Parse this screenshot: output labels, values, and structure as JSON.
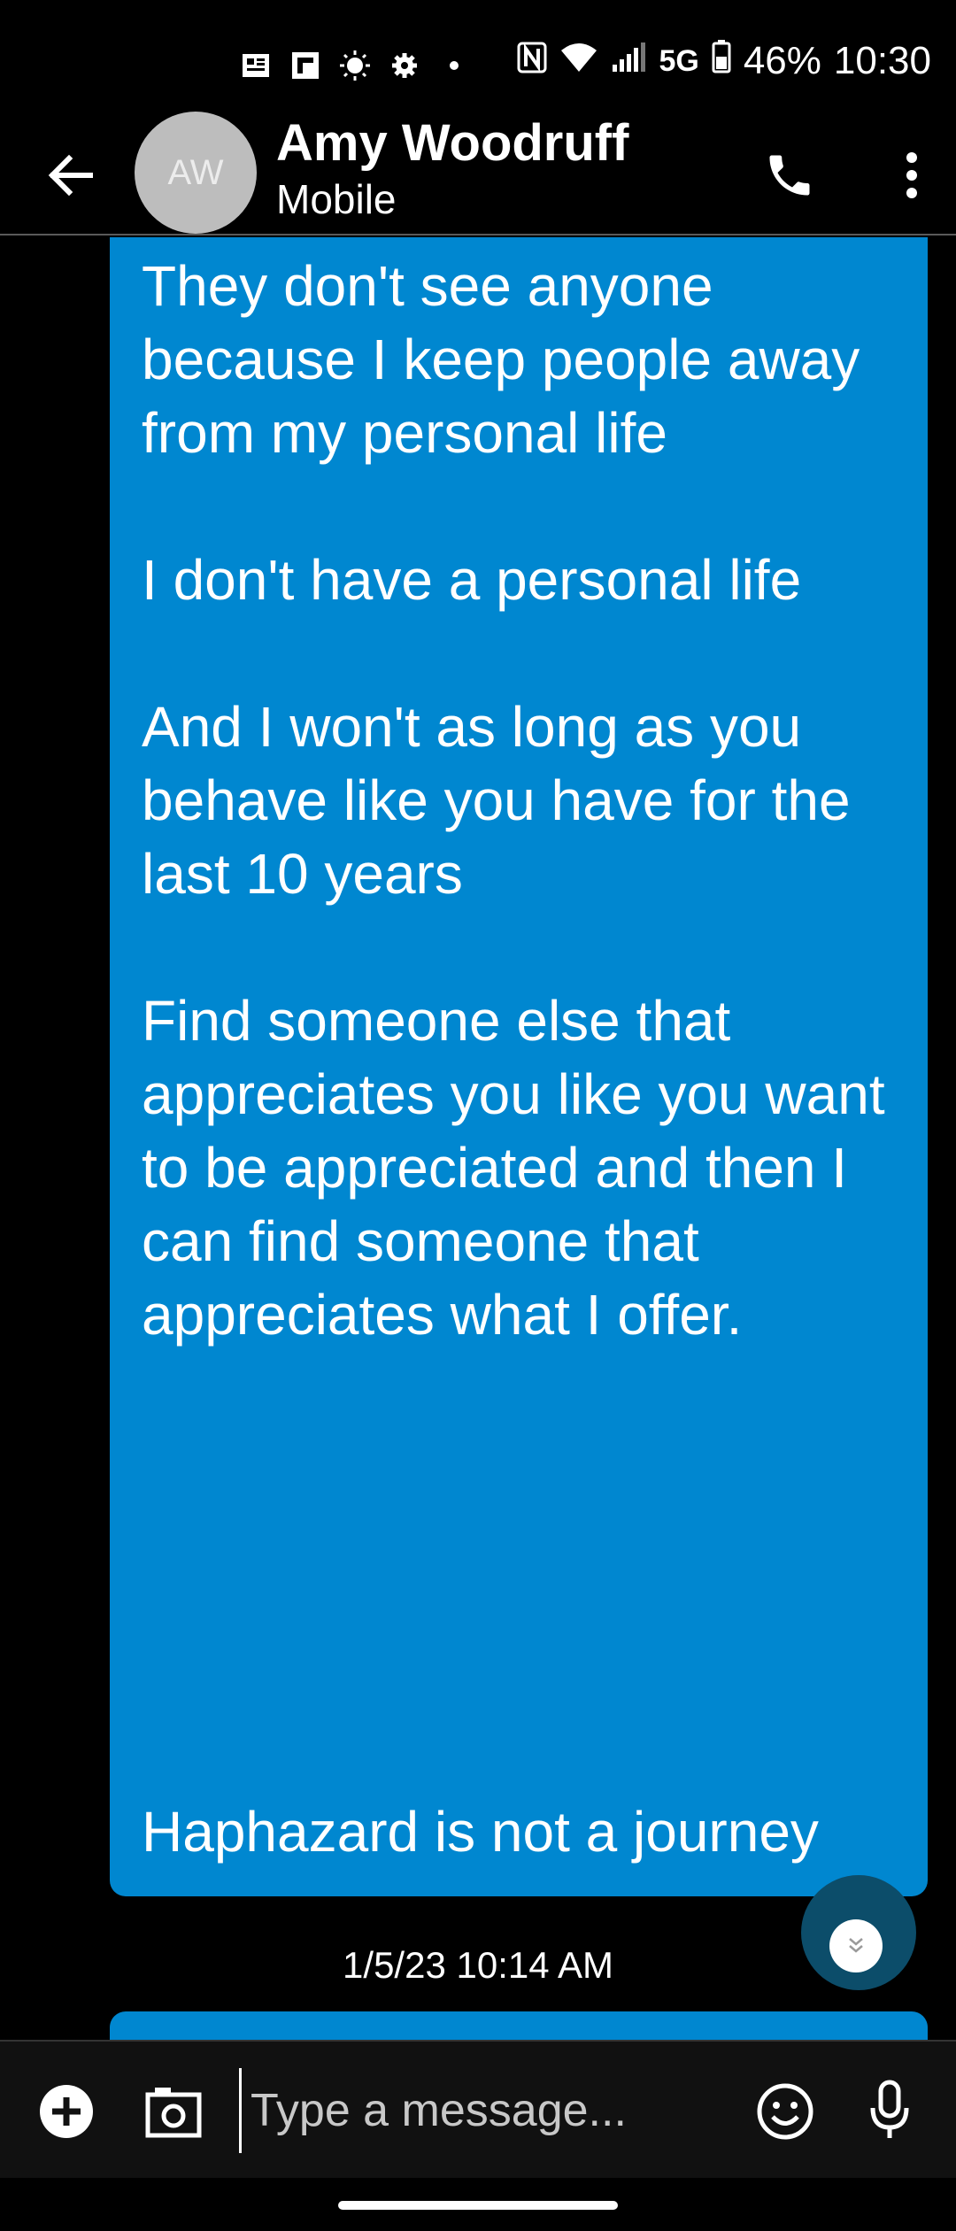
{
  "status_bar": {
    "signal_type": "5G",
    "battery": "46%",
    "time": "10:30",
    "icons": [
      "news-icon",
      "flipboard-icon",
      "brightness-icon",
      "settings-icon",
      "dot-icon",
      "nfc-icon",
      "wifi-icon",
      "signal-icon",
      "battery-icon"
    ]
  },
  "header": {
    "avatar_initials": "AW",
    "contact_name": "Amy Woodruff",
    "contact_subtitle": "Mobile"
  },
  "conversation": {
    "message_text": "They don't see anyone because I keep people away from my personal life\n\nI don't have a personal life\n\nAnd I won't as long as you behave like you have for the last 10 years\n\nFind someone else that appreciates you like you want to be appreciated and then I can find someone that appreciates what I offer.",
    "message_last_line": "Haphazard is not a journey",
    "timestamp": "1/5/23 10:14 AM",
    "bubble_color": "#0087d0"
  },
  "composer": {
    "placeholder": "Type a message..."
  }
}
